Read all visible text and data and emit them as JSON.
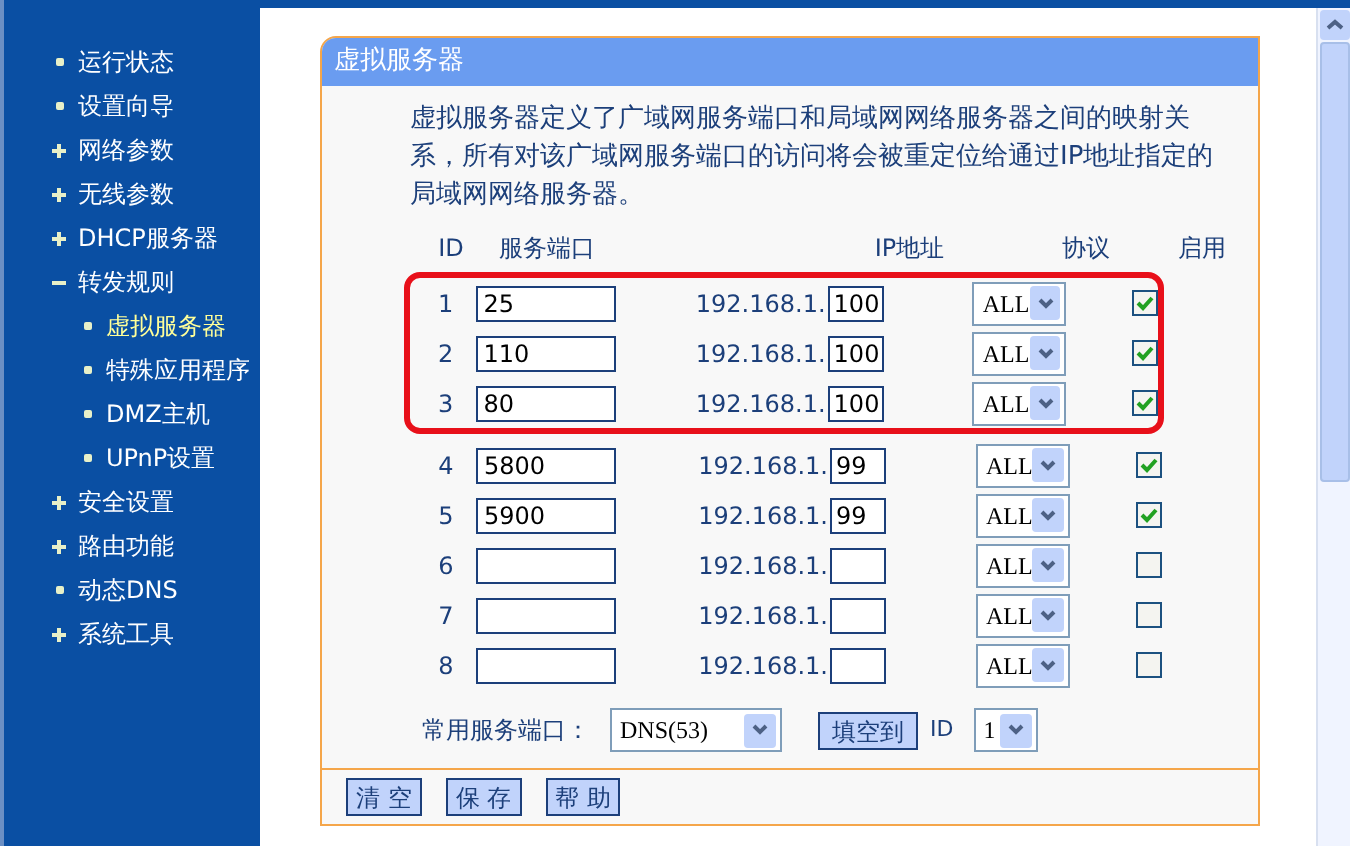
{
  "sidebar": {
    "items": [
      {
        "label": "运行状态",
        "kind": "leaf",
        "selected": false
      },
      {
        "label": "设置向导",
        "kind": "leaf",
        "selected": false
      },
      {
        "label": "网络参数",
        "kind": "collapsed",
        "selected": false
      },
      {
        "label": "无线参数",
        "kind": "collapsed",
        "selected": false
      },
      {
        "label": "DHCP服务器",
        "kind": "collapsed",
        "selected": false
      },
      {
        "label": "转发规则",
        "kind": "expanded",
        "selected": false,
        "children": [
          {
            "label": "虚拟服务器",
            "kind": "leaf",
            "selected": true
          },
          {
            "label": "特殊应用程序",
            "kind": "leaf",
            "selected": false
          },
          {
            "label": "DMZ主机",
            "kind": "leaf",
            "selected": false
          },
          {
            "label": "UPnP设置",
            "kind": "leaf",
            "selected": false
          }
        ]
      },
      {
        "label": "安全设置",
        "kind": "collapsed",
        "selected": false
      },
      {
        "label": "路由功能",
        "kind": "collapsed",
        "selected": false
      },
      {
        "label": "动态DNS",
        "kind": "leaf",
        "selected": false
      },
      {
        "label": "系统工具",
        "kind": "collapsed",
        "selected": false
      }
    ]
  },
  "panel": {
    "title": "虚拟服务器",
    "description": "虚拟服务器定义了广域网服务端口和局域网网络服务器之间的映射关系，所有对该广域网服务端口的访问将会被重定位给通过IP地址指定的局域网网络服务器。",
    "columns": [
      "ID",
      "服务端口",
      "IP地址",
      "协议",
      "启用"
    ],
    "row_groups": [
      {
        "highlighted": true,
        "rows": [
          {
            "id": "1",
            "port": "25",
            "ip_prefix": "192.168.1.",
            "ip_last": "100",
            "protocol": "ALL",
            "enabled": true
          },
          {
            "id": "2",
            "port": "110",
            "ip_prefix": "192.168.1.",
            "ip_last": "100",
            "protocol": "ALL",
            "enabled": true
          },
          {
            "id": "3",
            "port": "80",
            "ip_prefix": "192.168.1.",
            "ip_last": "100",
            "protocol": "ALL",
            "enabled": true
          }
        ]
      },
      {
        "highlighted": false,
        "rows": [
          {
            "id": "4",
            "port": "5800",
            "ip_prefix": "192.168.1.",
            "ip_last": "99",
            "protocol": "ALL",
            "enabled": true
          },
          {
            "id": "5",
            "port": "5900",
            "ip_prefix": "192.168.1.",
            "ip_last": "99",
            "protocol": "ALL",
            "enabled": true
          },
          {
            "id": "6",
            "port": "",
            "ip_prefix": "192.168.1.",
            "ip_last": "",
            "protocol": "ALL",
            "enabled": false
          },
          {
            "id": "7",
            "port": "",
            "ip_prefix": "192.168.1.",
            "ip_last": "",
            "protocol": "ALL",
            "enabled": false
          },
          {
            "id": "8",
            "port": "",
            "ip_prefix": "192.168.1.",
            "ip_last": "",
            "protocol": "ALL",
            "enabled": false
          }
        ]
      }
    ],
    "common_port": {
      "label": "常用服务端口：",
      "value": "DNS(53)",
      "fill_button": "填空到",
      "id_label": "ID",
      "id_value": "1"
    },
    "buttons": [
      "清 空",
      "保 存",
      "帮 助"
    ]
  }
}
